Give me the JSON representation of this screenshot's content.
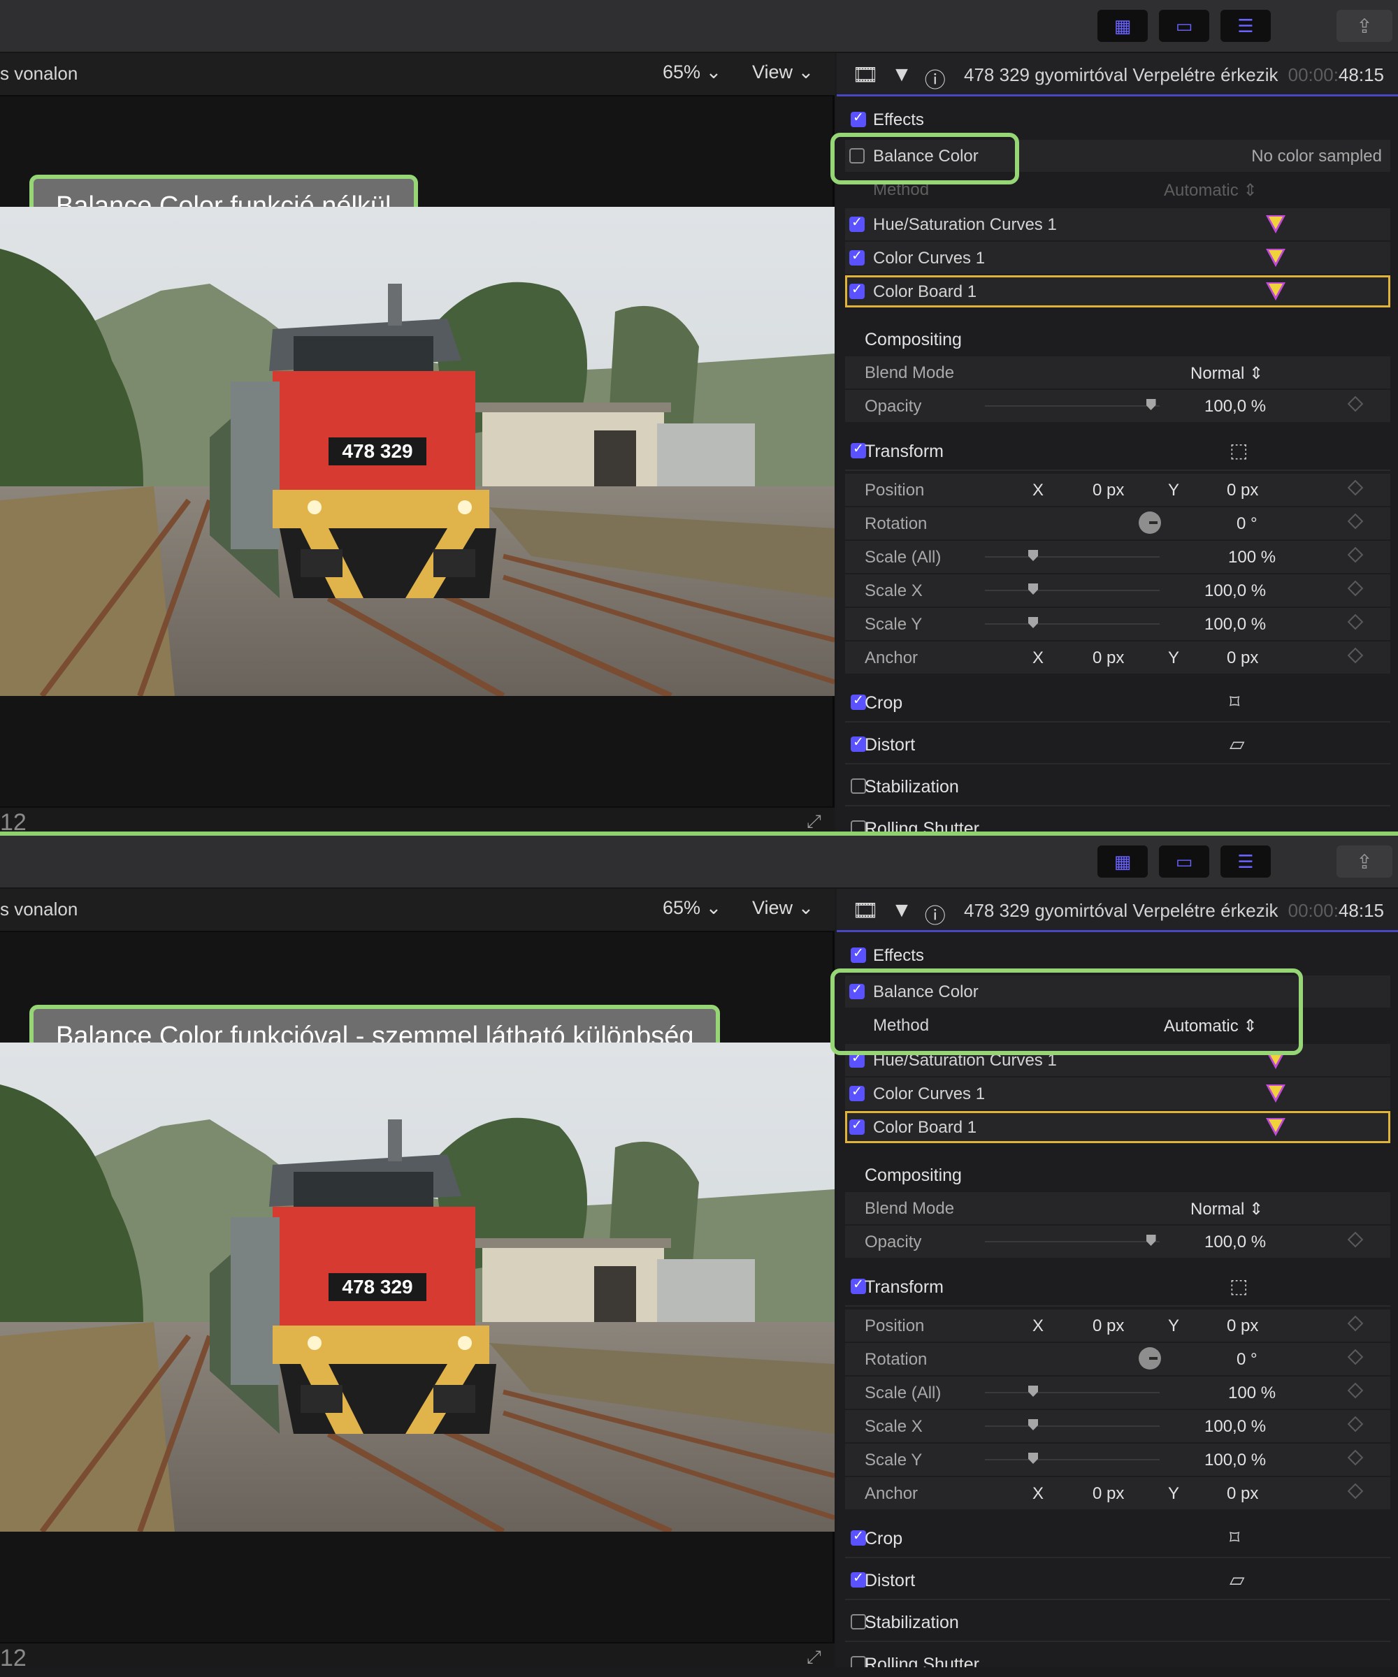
{
  "panels": [
    {
      "caption": "Balance Color funkció nélkül",
      "viewer": {
        "title": "s vonalon",
        "zoom": "65%",
        "view": "View",
        "timecode_partial": "12"
      },
      "photo": {
        "locomotive_number": "478 329"
      },
      "inspector": {
        "clip_title": "478 329 gyomirtóval Verpelétre érkezik",
        "timecode_dim": "00:00:",
        "timecode_lit": "48:15",
        "effects_label": "Effects",
        "balance_color": {
          "label": "Balance Color",
          "status": "No color sampled",
          "checked": false
        },
        "method": {
          "label": "Method",
          "value": "Automatic"
        },
        "effects": [
          "Hue/Saturation Curves 1",
          "Color Curves 1",
          "Color Board 1"
        ],
        "compositing": {
          "label": "Compositing",
          "blend_label": "Blend Mode",
          "blend_value": "Normal",
          "opacity_label": "Opacity",
          "opacity_value": "100,0 %",
          "opacity_level": 0.95
        },
        "transform": {
          "label": "Transform",
          "position": {
            "label": "Position",
            "x": "0 px",
            "y": "0 px"
          },
          "rotation": {
            "label": "Rotation",
            "value": "0 °"
          },
          "scale_all": {
            "label": "Scale (All)",
            "value": "100 %"
          },
          "scale_x": {
            "label": "Scale X",
            "value": "100,0 %"
          },
          "scale_y": {
            "label": "Scale Y",
            "value": "100,0 %"
          },
          "anchor": {
            "label": "Anchor",
            "x": "0 px",
            "y": "0 px"
          }
        },
        "crop": "Crop",
        "distort": "Distort",
        "stabilization": "Stabilization",
        "rolling_shutter": "Rolling Shutter"
      }
    },
    {
      "caption": "Balance Color funkcióval - szemmel látható különbség",
      "viewer": {
        "title": "s vonalon",
        "zoom": "65%",
        "view": "View",
        "timecode_partial": "12"
      },
      "photo": {
        "locomotive_number": "478 329"
      },
      "inspector": {
        "clip_title": "478 329 gyomirtóval Verpelétre érkezik",
        "timecode_dim": "00:00:",
        "timecode_lit": "48:15",
        "effects_label": "Effects",
        "balance_color": {
          "label": "Balance Color",
          "status": "",
          "checked": true
        },
        "method": {
          "label": "Method",
          "value": "Automatic"
        },
        "effects": [
          "Hue/Saturation Curves 1",
          "Color Curves 1",
          "Color Board 1"
        ],
        "compositing": {
          "label": "Compositing",
          "blend_label": "Blend Mode",
          "blend_value": "Normal",
          "opacity_label": "Opacity",
          "opacity_value": "100,0 %",
          "opacity_level": 0.95
        },
        "transform": {
          "label": "Transform",
          "position": {
            "label": "Position",
            "x": "0 px",
            "y": "0 px"
          },
          "rotation": {
            "label": "Rotation",
            "value": "0 °"
          },
          "scale_all": {
            "label": "Scale (All)",
            "value": "100 %"
          },
          "scale_x": {
            "label": "Scale X",
            "value": "100,0 %"
          },
          "scale_y": {
            "label": "Scale Y",
            "value": "100,0 %"
          },
          "anchor": {
            "label": "Anchor",
            "x": "0 px",
            "y": "0 px"
          }
        },
        "crop": "Crop",
        "distort": "Distort",
        "stabilization": "Stabilization",
        "rolling_shutter": "Rolling Shutter"
      }
    }
  ],
  "icons": {
    "browser": "grid-icon",
    "timeline": "filmstrip-icon",
    "inspector": "sliders-icon",
    "share": "share-icon"
  },
  "colors": {
    "accent": "#5b52ff",
    "callout": "#97d677",
    "selected": "#e0b43a"
  }
}
